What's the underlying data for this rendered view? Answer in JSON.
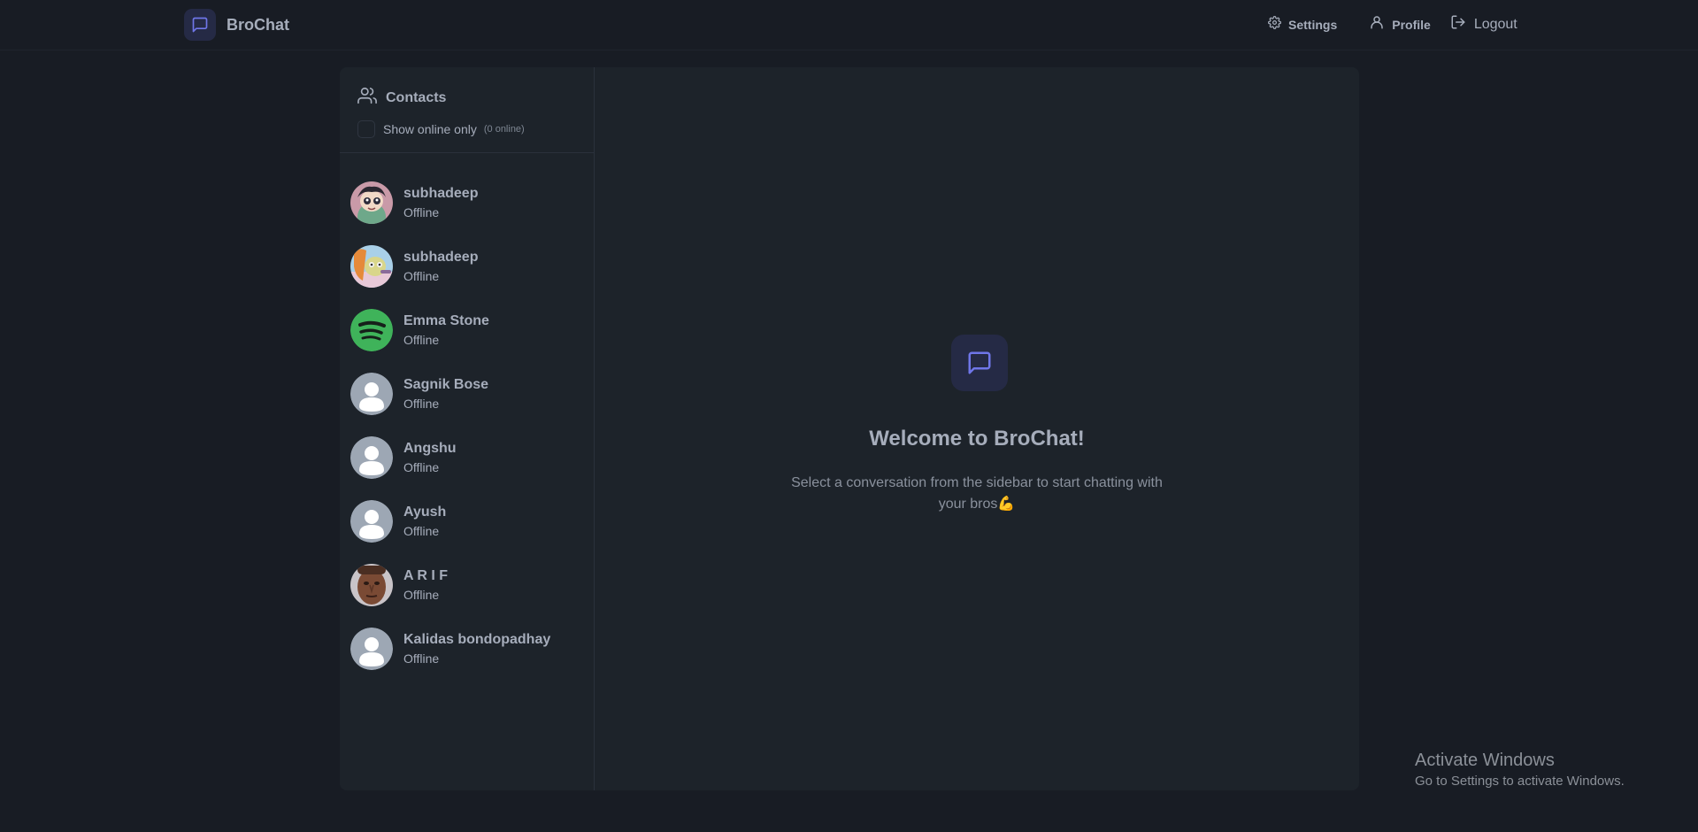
{
  "app": {
    "name": "BroChat"
  },
  "nav": {
    "settings_label": "Settings",
    "profile_label": "Profile",
    "logout_label": "Logout"
  },
  "sidebar": {
    "title": "Contacts",
    "online_toggle_label": "Show online only",
    "online_count": "(0 online)",
    "contacts": [
      {
        "name": "subhadeep",
        "status": "Offline",
        "avatar": "cartoon-avatar"
      },
      {
        "name": "subhadeep",
        "status": "Offline",
        "avatar": "cartoon-avatar"
      },
      {
        "name": "Emma Stone",
        "status": "Offline",
        "avatar": "spotify-logo-avatar"
      },
      {
        "name": "Sagnik Bose",
        "status": "Offline",
        "avatar": "default-avatar"
      },
      {
        "name": "Angshu",
        "status": "Offline",
        "avatar": "default-avatar"
      },
      {
        "name": "Ayush",
        "status": "Offline",
        "avatar": "default-avatar"
      },
      {
        "name": "A R I F",
        "status": "Offline",
        "avatar": "photo-avatar"
      },
      {
        "name": "Kalidas bondopadhay",
        "status": "Offline",
        "avatar": "default-avatar"
      }
    ]
  },
  "welcome": {
    "title": "Welcome to BroChat!",
    "subtitle": "Select a conversation from the sidebar to start chatting with your bros💪"
  },
  "watermark": {
    "line1": "Activate Windows",
    "line2": "Go to Settings to activate Windows."
  },
  "colors": {
    "background": "#181c24",
    "panel": "#1d232a",
    "accent": "#6f76e8",
    "text": "#a6adbb"
  }
}
